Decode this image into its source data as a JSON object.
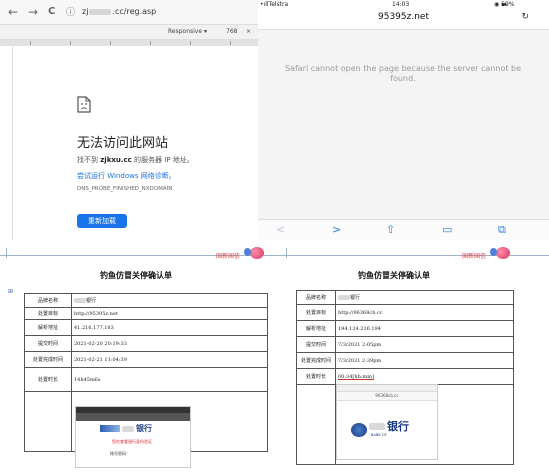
{
  "browser": {
    "nav": {
      "back": "←",
      "forward": "→",
      "reload": "C",
      "info": "ⓘ"
    },
    "url_prefix": "zj",
    "url_suffix": ".cc/reg.asp",
    "responsive_label": "Responsive ▾",
    "responsive_width": "768",
    "error_title": "无法访问此网站",
    "error_sub_prefix": "找不到 ",
    "error_sub_domain": "zjkxu.cc",
    "error_sub_suffix": " 的服务器 IP 地址。",
    "error_link": "尝试运行 Windows 网络诊断。",
    "error_code": "DNS_PROBE_FINISHED_NXDOMAIN",
    "reload_button": "重新加载"
  },
  "phone": {
    "carrier": "Telstra 4G",
    "time": "14:03",
    "battery": "59%",
    "domain": "95395z.net",
    "message": "Safari cannot open the page because the server cannot be found.",
    "toolbar": {
      "back": "<",
      "forward": ">",
      "share": "⇧",
      "bookmarks": "▭",
      "tabs": "⧉"
    }
  },
  "docs": {
    "logo_text": "国新国信",
    "left": {
      "title": "钓鱼仿冒关停确认单",
      "rows": [
        {
          "label": "品牌名称",
          "value": "银行"
        },
        {
          "label": "处置目标",
          "value": "http://95395z.net"
        },
        {
          "label": "解析地址",
          "value": "41.216.177.183"
        },
        {
          "label": "提交时间",
          "value": "2021-02-20 20:19:33"
        },
        {
          "label": "处置完成时间",
          "value": "2021-02-21 11:04:39"
        },
        {
          "label": "处置时长",
          "value": "14h45m6s"
        }
      ],
      "shot_bank": "银行",
      "shot_red_text": "您在查看银行身份验证",
      "shot_field": "帐号密码："
    },
    "right": {
      "title": "钓鱼仿冒关停确认单",
      "rows": [
        {
          "label": "品牌名称",
          "value": "银行"
        },
        {
          "label": "处置目标",
          "value": "http://96368cb.cc"
        },
        {
          "label": "解析地址",
          "value": "194.124.216.194"
        },
        {
          "label": "提交时间",
          "value": "7/3/2021 2:05pm"
        },
        {
          "label": "处置完成时间",
          "value": "7/3/2021 2:39pm"
        },
        {
          "label": "处置时长",
          "value": "00:34[hh:mm]"
        }
      ],
      "shot_domain": "96368cb.cc",
      "shot_bank": "银行",
      "shot_bank_en": "BANK OF"
    }
  }
}
